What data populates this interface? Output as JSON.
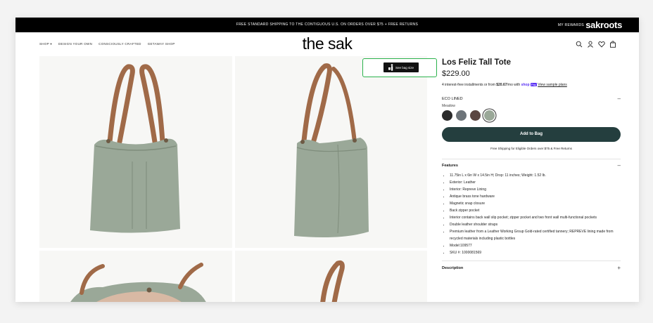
{
  "promo": {
    "text": "FREE STANDARD SHIPPING TO THE CONTIGUOUS U.S. ON ORDERS OVER $75 + FREE RETURNS",
    "rewards": "MY REWARDS",
    "brand": "sakroots"
  },
  "nav": {
    "items": [
      "SHOP ▾",
      "DESIGN YOUR OWN",
      "CONSCIOUSLY CRAFTED",
      "GETAWAY SHOP"
    ]
  },
  "logo": "the sak",
  "header_icons": [
    "search-icon",
    "user-icon",
    "heart-icon",
    "bag-icon"
  ],
  "gallery": {
    "see_bag_size": "See bag size",
    "background": "#f7f7f5",
    "leather_color": "#9aa898",
    "strap_color": "#a06a48"
  },
  "product": {
    "title": "Los Feliz Tall Tote",
    "price": "$229.00",
    "installments": {
      "prefix": "4 interest-free installments or from ",
      "amount": "$20.67",
      "suffix": "/mo with ",
      "provider": "shop",
      "badge": "Pay",
      "link": "View sample plans"
    },
    "eco_label": "ECO LINED",
    "eco_sign": "–",
    "color_name": "Meadow",
    "swatches": [
      {
        "name": "black",
        "hex": "#2a2a2a"
      },
      {
        "name": "slate",
        "hex": "#6d7479"
      },
      {
        "name": "mocha",
        "hex": "#5b4641"
      },
      {
        "name": "meadow",
        "hex": "#9aa898",
        "selected": true
      }
    ],
    "add_to_bag": "Add to Bag",
    "free_shipping": "Free Shipping for Eligible Orders over $75 & Free Returns",
    "features_title": "Features",
    "features_sign": "–",
    "features": [
      "11.75in L x 6in W x 14.5in H; Drop: 11 inches; Weight: 1.52 lb.",
      "Exterior: Leather",
      "Interior: Repreve Lining",
      "Antique brass tone hardware",
      "Magnetic snap closure",
      "Back zipper pocket",
      "Interior contains back wall slip pocket; zipper pocket and two front wall multi-functional pockets",
      "Double leather shoulder straps",
      "Premium leather from a Leather Working Group Gold-rated certified tannery; REPREVE lining made from recycled materials including plastic bottles",
      "Model:109577",
      "SKU #: 1000081569"
    ],
    "description_title": "Description",
    "description_sign": "+"
  }
}
